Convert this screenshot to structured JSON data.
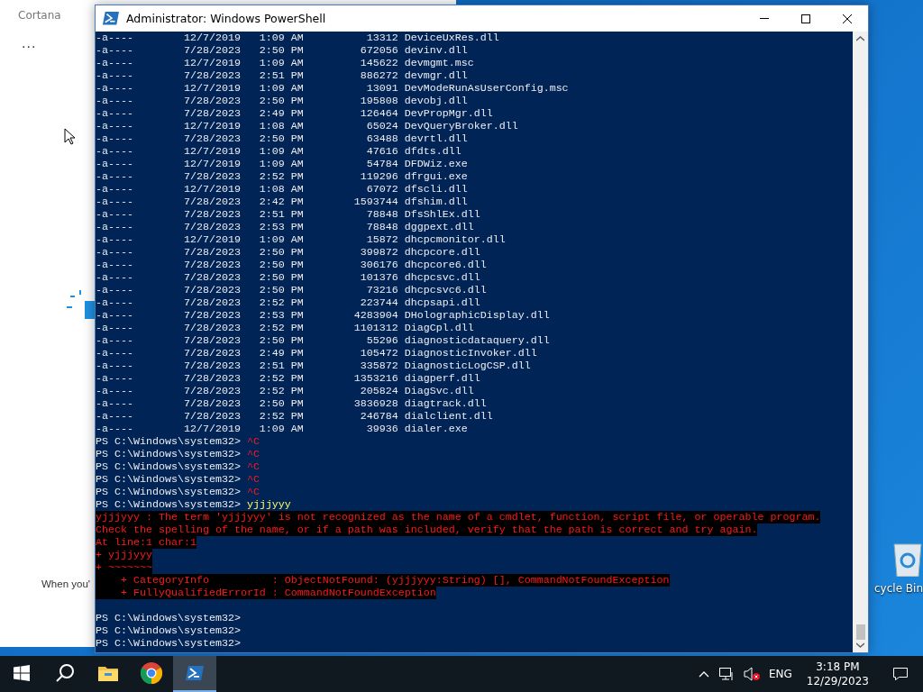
{
  "cortana": {
    "title": "Cortana",
    "more": "...",
    "message": "When you'"
  },
  "desktop": {
    "recycle_bin": "cycle Bin"
  },
  "window": {
    "title": "Administrator: Windows PowerShell"
  },
  "console": {
    "lines": [
      {
        "kind": "output",
        "text": "-a----        12/7/2019   1:09 AM          13312 DeviceUxRes.dll"
      },
      {
        "kind": "output",
        "text": "-a----        7/28/2023   2:50 PM         672056 devinv.dll"
      },
      {
        "kind": "output",
        "text": "-a----        12/7/2019   1:09 AM         145622 devmgmt.msc"
      },
      {
        "kind": "output",
        "text": "-a----        7/28/2023   2:51 PM         886272 devmgr.dll"
      },
      {
        "kind": "output",
        "text": "-a----        12/7/2019   1:09 AM          13091 DevModeRunAsUserConfig.msc"
      },
      {
        "kind": "output",
        "text": "-a----        7/28/2023   2:50 PM         195808 devobj.dll"
      },
      {
        "kind": "output",
        "text": "-a----        7/28/2023   2:49 PM         126464 DevPropMgr.dll"
      },
      {
        "kind": "output",
        "text": "-a----        12/7/2019   1:08 AM          65024 DevQueryBroker.dll"
      },
      {
        "kind": "output",
        "text": "-a----        7/28/2023   2:50 PM          63488 devrtl.dll"
      },
      {
        "kind": "output",
        "text": "-a----        12/7/2019   1:09 AM          47616 dfdts.dll"
      },
      {
        "kind": "output",
        "text": "-a----        12/7/2019   1:09 AM          54784 DFDWiz.exe"
      },
      {
        "kind": "output",
        "text": "-a----        7/28/2023   2:52 PM         119296 dfrgui.exe"
      },
      {
        "kind": "output",
        "text": "-a----        12/7/2019   1:08 AM          67072 dfscli.dll"
      },
      {
        "kind": "output",
        "text": "-a----        7/28/2023   2:42 PM        1593744 dfshim.dll"
      },
      {
        "kind": "output",
        "text": "-a----        7/28/2023   2:51 PM          78848 DfsShlEx.dll"
      },
      {
        "kind": "output",
        "text": "-a----        7/28/2023   2:53 PM          78848 dggpext.dll"
      },
      {
        "kind": "output",
        "text": "-a----        12/7/2019   1:09 AM          15872 dhcpcmonitor.dll"
      },
      {
        "kind": "output",
        "text": "-a----        7/28/2023   2:50 PM         399872 dhcpcore.dll"
      },
      {
        "kind": "output",
        "text": "-a----        7/28/2023   2:50 PM         306176 dhcpcore6.dll"
      },
      {
        "kind": "output",
        "text": "-a----        7/28/2023   2:50 PM         101376 dhcpcsvc.dll"
      },
      {
        "kind": "output",
        "text": "-a----        7/28/2023   2:50 PM          73216 dhcpcsvc6.dll"
      },
      {
        "kind": "output",
        "text": "-a----        7/28/2023   2:52 PM         223744 dhcpsapi.dll"
      },
      {
        "kind": "output",
        "text": "-a----        7/28/2023   2:53 PM        4283904 DHolographicDisplay.dll"
      },
      {
        "kind": "output",
        "text": "-a----        7/28/2023   2:52 PM        1101312 DiagCpl.dll"
      },
      {
        "kind": "output",
        "text": "-a----        7/28/2023   2:50 PM          55296 diagnosticdataquery.dll"
      },
      {
        "kind": "output",
        "text": "-a----        7/28/2023   2:49 PM         105472 DiagnosticInvoker.dll"
      },
      {
        "kind": "output",
        "text": "-a----        7/28/2023   2:51 PM         335872 DiagnosticLogCSP.dll"
      },
      {
        "kind": "output",
        "text": "-a----        7/28/2023   2:52 PM        1353216 diagperf.dll"
      },
      {
        "kind": "output",
        "text": "-a----        7/28/2023   2:52 PM         205824 DiagSvc.dll"
      },
      {
        "kind": "output",
        "text": "-a----        7/28/2023   2:50 PM        3836928 diagtrack.dll"
      },
      {
        "kind": "output",
        "text": "-a----        7/28/2023   2:52 PM         246784 dialclient.dll"
      },
      {
        "kind": "output",
        "text": "-a----        12/7/2019   1:09 AM          39936 dialer.exe"
      },
      {
        "kind": "interrupt",
        "prompt": "PS C:\\Windows\\system32>",
        "input": "^C"
      },
      {
        "kind": "interrupt",
        "prompt": "PS C:\\Windows\\system32>",
        "input": "^C"
      },
      {
        "kind": "interrupt",
        "prompt": "PS C:\\Windows\\system32>",
        "input": "^C"
      },
      {
        "kind": "interrupt",
        "prompt": "PS C:\\Windows\\system32>",
        "input": "^C"
      },
      {
        "kind": "interrupt",
        "prompt": "PS C:\\Windows\\system32>",
        "input": "^C"
      },
      {
        "kind": "command",
        "prompt": "PS C:\\Windows\\system32>",
        "input": "yjjjyyy"
      },
      {
        "kind": "error",
        "text": "yjjjyyy : The term 'yjjjyyy' is not recognized as the name of a cmdlet, function, script file, or operable program."
      },
      {
        "kind": "error",
        "text": "Check the spelling of the name, or if a path was included, verify that the path is correct and try again."
      },
      {
        "kind": "error",
        "text": "At line:1 char:1"
      },
      {
        "kind": "error",
        "text": "+ yjjjyyy"
      },
      {
        "kind": "error",
        "text": "+ ~~~~~~~"
      },
      {
        "kind": "error",
        "text": "    + CategoryInfo          : ObjectNotFound: (yjjjyyy:String) [], CommandNotFoundException"
      },
      {
        "kind": "error",
        "text": "    + FullyQualifiedErrorId : CommandNotFoundException"
      },
      {
        "kind": "blank"
      },
      {
        "kind": "prompt",
        "prompt": "PS C:\\Windows\\system32>"
      },
      {
        "kind": "prompt",
        "prompt": "PS C:\\Windows\\system32>"
      },
      {
        "kind": "prompt",
        "prompt": "PS C:\\Windows\\system32>"
      }
    ]
  },
  "taskbar": {
    "apps": [
      {
        "kind": "start",
        "selected": false
      },
      {
        "kind": "search",
        "selected": false
      },
      {
        "kind": "explorer",
        "selected": false
      },
      {
        "kind": "chrome",
        "selected": false
      },
      {
        "kind": "powershell",
        "selected": true
      }
    ],
    "language": "ENG",
    "time": "3:18 PM",
    "date": "12/29/2023"
  }
}
